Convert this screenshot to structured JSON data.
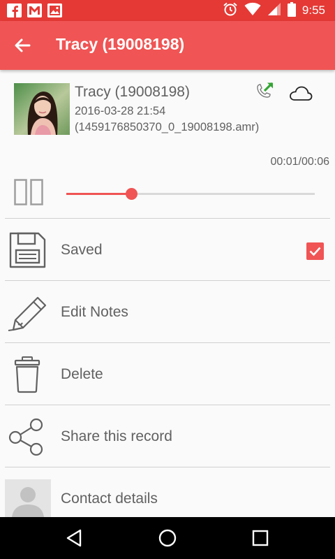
{
  "status_bar": {
    "time": "9:55",
    "left_icons": [
      "facebook-icon",
      "gmail-icon",
      "gallery-icon"
    ],
    "right_icons": [
      "alarm-icon",
      "wifi-icon",
      "signal-icon",
      "battery-icon"
    ],
    "color": "#e53935"
  },
  "app_bar": {
    "title": "Tracy (19008198)",
    "color": "#f05454"
  },
  "record": {
    "name": "Tracy (19008198)",
    "date": "2016-03-28 21:54",
    "file": "(1459176850370_0_19008198.amr)"
  },
  "player": {
    "time": "00:01/00:06",
    "progress": 0.26
  },
  "actions": [
    {
      "label": "Saved",
      "icon": "floppy-disk-icon",
      "checked": true
    },
    {
      "label": "Edit Notes",
      "icon": "pencil-icon"
    },
    {
      "label": "Delete",
      "icon": "trash-icon"
    },
    {
      "label": "Share this record",
      "icon": "share-icon"
    },
    {
      "label": "Contact details",
      "icon": "contact-avatar-icon"
    }
  ],
  "accent_color": "#f05454"
}
